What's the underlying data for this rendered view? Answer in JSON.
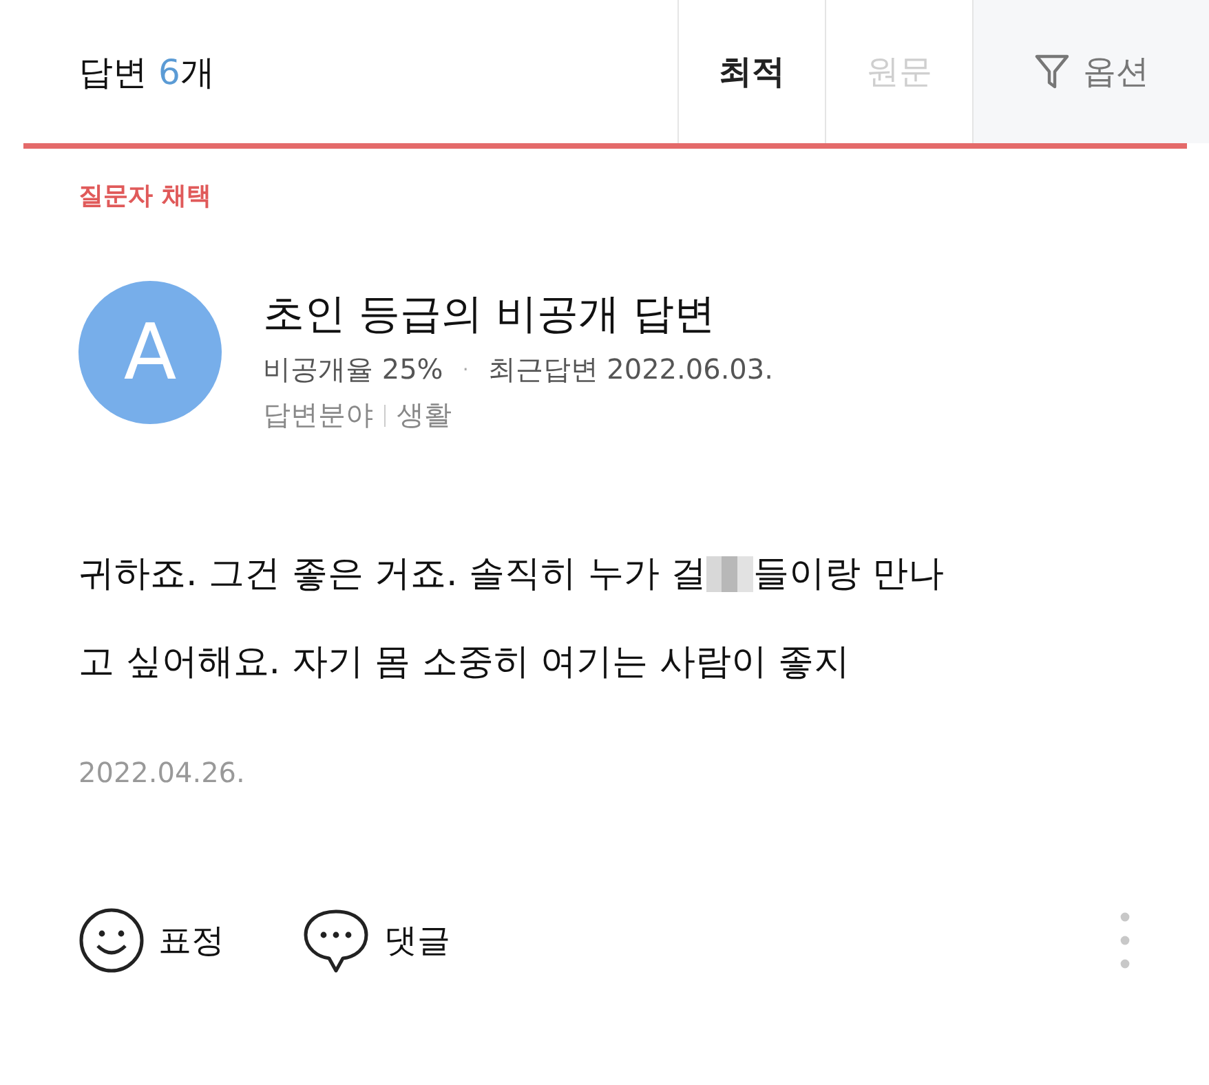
{
  "header": {
    "label": "답변",
    "count": "6",
    "suffix": "개",
    "sort_tabs": [
      {
        "label": "최적",
        "selected": true,
        "disabled": false
      },
      {
        "label": "원문",
        "selected": false,
        "disabled": true
      }
    ],
    "options_button": {
      "label": "옵션"
    }
  },
  "answer": {
    "badge": "질문자 채택",
    "author": {
      "avatar_letter": "A",
      "name": "초인 등급의 비공개 답변",
      "private_rate": "비공개율 25%",
      "separator": "·",
      "recent": "최근답변 2022.06.03.",
      "field_label": "답변분야",
      "field_value": "생활"
    },
    "text_lines": [
      {
        "parts": [
          "귀하죠. 그건 좋은 거죠. 솔직히 누가 걸",
          "들이랑 만나"
        ]
      },
      {
        "parts": [
          "고 싶어해요. 자기 몸 소중히 여기는 사람이 좋지"
        ]
      }
    ],
    "date": "2022.04.26.",
    "actions": [
      {
        "kind": "emoji",
        "label": "표정"
      },
      {
        "kind": "comment",
        "label": "댓글"
      }
    ]
  }
}
